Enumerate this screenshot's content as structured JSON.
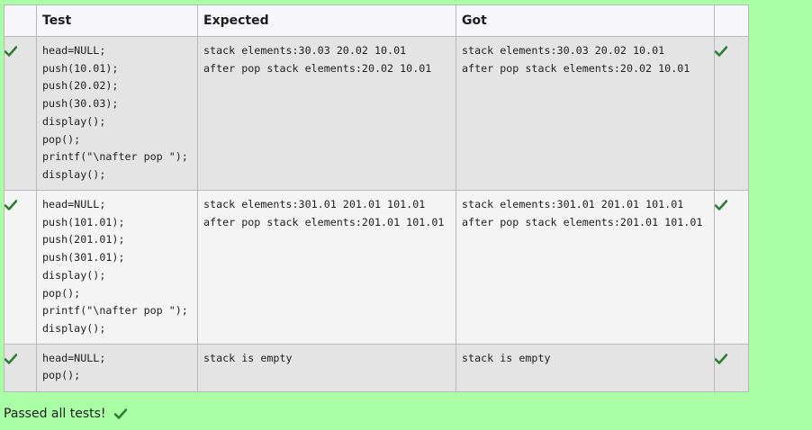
{
  "table": {
    "headers": [
      "",
      "Test",
      "Expected",
      "Got",
      ""
    ],
    "rows": [
      {
        "test": "head=NULL;\npush(10.01);\npush(20.02);\npush(30.03);\ndisplay();\npop();\nprintf(\"\\nafter pop \");\ndisplay();",
        "expected": "stack elements:30.03 20.02 10.01\nafter pop stack elements:20.02 10.01",
        "got": "stack elements:30.03 20.02 10.01\nafter pop stack elements:20.02 10.01",
        "status_icon": "check-icon"
      },
      {
        "test": "head=NULL;\npush(101.01);\npush(201.01);\npush(301.01);\ndisplay();\npop();\nprintf(\"\\nafter pop \");\ndisplay();",
        "expected": "stack elements:301.01 201.01 101.01\nafter pop stack elements:201.01 101.01",
        "got": "stack elements:301.01 201.01 101.01\nafter pop stack elements:201.01 101.01",
        "status_icon": "check-icon"
      },
      {
        "test": "head=NULL;\npop();",
        "expected": "stack is empty",
        "got": "stack is empty",
        "status_icon": "check-icon"
      }
    ]
  },
  "summary": {
    "text": "Passed all tests!",
    "icon": "check-icon"
  },
  "colors": {
    "page_background": "#aaffa6",
    "check_green": "#2e7d32",
    "header_background": "#f7f7fb",
    "row_odd": "#e4e4e4",
    "row_even": "#f4f4f4"
  }
}
